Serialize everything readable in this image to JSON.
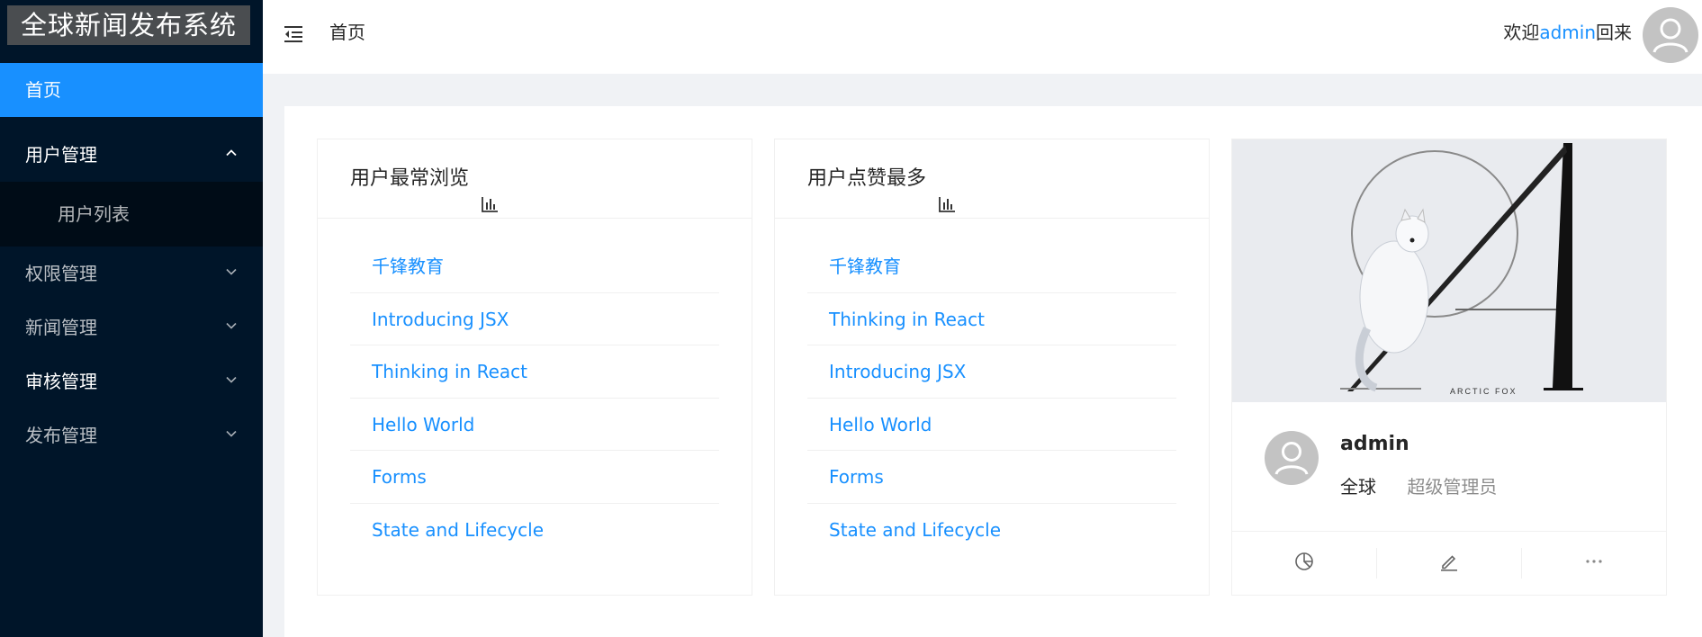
{
  "app": {
    "title": "全球新闻发布系统"
  },
  "sidebar": {
    "items": [
      {
        "label": "首页",
        "active": true
      },
      {
        "label": "用户管理",
        "expanded": true,
        "children": [
          {
            "label": "用户列表"
          }
        ]
      },
      {
        "label": "权限管理"
      },
      {
        "label": "新闻管理"
      },
      {
        "label": "审核管理"
      },
      {
        "label": "发布管理"
      }
    ],
    "icons": {
      "expanded": "chevron-up-icon",
      "collapsed": "chevron-down-icon"
    }
  },
  "header": {
    "fold_icon": "menu-fold-icon",
    "breadcrumb": "首页",
    "welcome_prefix": "欢迎",
    "username": "admin",
    "welcome_suffix": "回来",
    "avatar_icon": "user-icon"
  },
  "cards": {
    "most_viewed": {
      "title": "用户最常浏览",
      "icon": "bar-chart-icon",
      "items": [
        "千锋教育",
        "Introducing JSX",
        "Thinking in React",
        "Hello World",
        "Forms",
        "State and Lifecycle"
      ]
    },
    "most_liked": {
      "title": "用户点赞最多",
      "icon": "bar-chart-icon",
      "items": [
        "千锋教育",
        "Thinking in React",
        "Introducing JSX",
        "Hello World",
        "Forms",
        "State and Lifecycle"
      ]
    },
    "profile": {
      "cover_text": "ARCTIC FOX",
      "name": "admin",
      "region": "全球",
      "role": "超级管理员",
      "actions": [
        "pie-chart-icon",
        "edit-icon",
        "ellipsis-icon"
      ]
    }
  },
  "colors": {
    "sider_bg": "#001529",
    "submenu_bg": "#000c17",
    "primary": "#1890ff",
    "page_bg": "#f0f2f5"
  }
}
